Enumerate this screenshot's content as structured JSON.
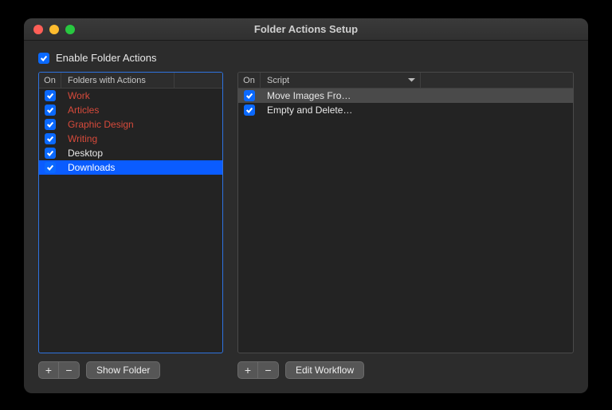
{
  "window": {
    "title": "Folder Actions Setup"
  },
  "enable": {
    "label": "Enable Folder Actions",
    "checked": true
  },
  "folders": {
    "header_on": "On",
    "header_name": "Folders with Actions",
    "items": [
      {
        "on": true,
        "name": "Work",
        "missing": true,
        "selected": false
      },
      {
        "on": true,
        "name": "Articles",
        "missing": true,
        "selected": false
      },
      {
        "on": true,
        "name": "Graphic Design",
        "missing": true,
        "selected": false
      },
      {
        "on": true,
        "name": "Writing",
        "missing": true,
        "selected": false
      },
      {
        "on": true,
        "name": "Desktop",
        "missing": false,
        "selected": false
      },
      {
        "on": true,
        "name": "Downloads",
        "missing": false,
        "selected": true
      }
    ],
    "buttons": {
      "add": "+",
      "remove": "−",
      "show": "Show Folder"
    }
  },
  "scripts": {
    "header_on": "On",
    "header_name": "Script",
    "items": [
      {
        "on": true,
        "name": "Move Images Fro…",
        "selected": true
      },
      {
        "on": true,
        "name": "Empty and Delete…",
        "selected": false
      }
    ],
    "buttons": {
      "add": "+",
      "remove": "−",
      "edit": "Edit Workflow"
    }
  }
}
